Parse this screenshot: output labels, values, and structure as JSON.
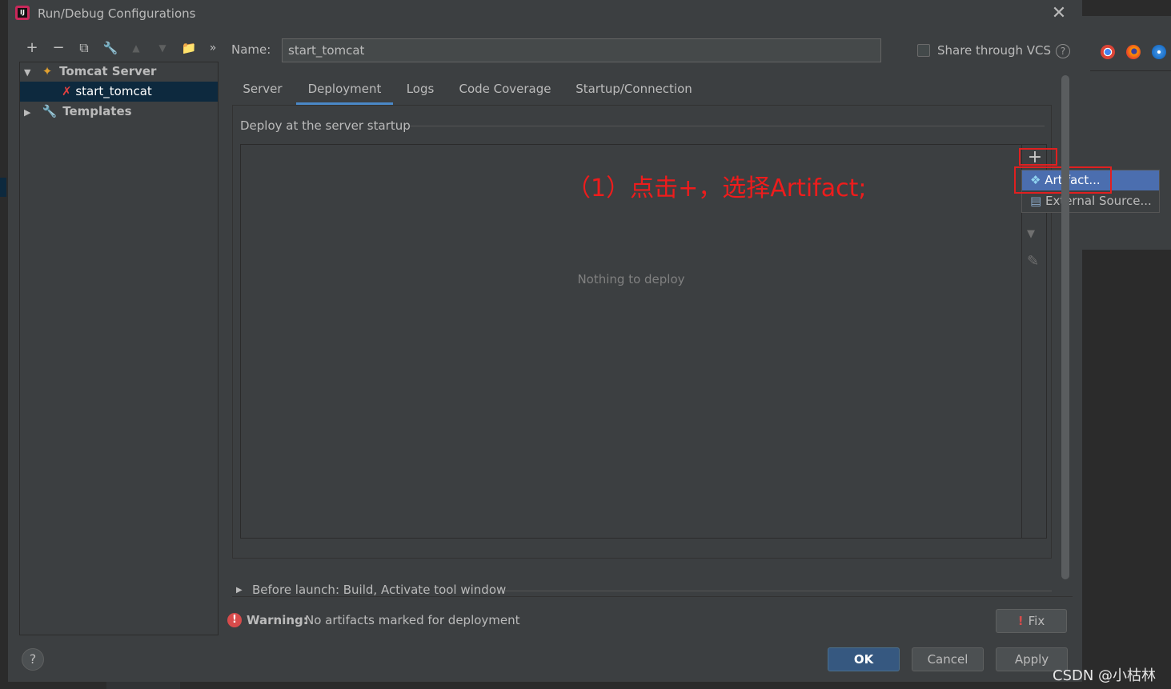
{
  "window": {
    "title": "Run/Debug Configurations",
    "logo_text": "IJ"
  },
  "toolbar": {
    "add": "+",
    "remove": "−",
    "copy": "⧉",
    "edit_defaults": "🔧",
    "move_up": "▲",
    "move_down": "▼",
    "folder": "📁",
    "more": "»"
  },
  "tree": {
    "items": [
      {
        "label": "Tomcat Server",
        "expanded": true,
        "icon": "tomcat-icon"
      },
      {
        "label": "start_tomcat",
        "selected": true,
        "icon": "tomcat-config-icon"
      },
      {
        "label": "Templates",
        "expanded": false,
        "icon": "wrench-icon"
      }
    ]
  },
  "name_row": {
    "label": "Name:",
    "value": "start_tomcat"
  },
  "vcs": {
    "label": "Share through VCS",
    "checked": false,
    "help": "?"
  },
  "tabs": [
    {
      "label": "Server"
    },
    {
      "label": "Deployment",
      "active": true
    },
    {
      "label": "Logs"
    },
    {
      "label": "Code Coverage"
    },
    {
      "label": "Startup/Connection"
    }
  ],
  "deployment": {
    "section_title": "Deploy at the server startup",
    "empty_text": "Nothing to deploy",
    "add_icon": "+",
    "popup": [
      {
        "label": "Artifact...",
        "icon": "artifact-icon",
        "selected": true
      },
      {
        "label": "External Source...",
        "icon": "external-source-icon"
      }
    ]
  },
  "annotation": "（1）点击+，选择Artifact;",
  "before_launch": {
    "text": "Before launch: Build, Activate tool window"
  },
  "warning": {
    "title": "Warning:",
    "message": "No artifacts marked for deployment",
    "fix_label": "Fix"
  },
  "buttons": {
    "help": "?",
    "ok": "OK",
    "cancel": "Cancel",
    "apply": "Apply"
  },
  "close_icon": "✕",
  "watermark": "CSDN @小枯林",
  "colors": {
    "accent": "#4a88c7",
    "selected_menu": "#4b6eaf",
    "ok_button": "#365880",
    "annotation_red": "#ee1c1c"
  }
}
